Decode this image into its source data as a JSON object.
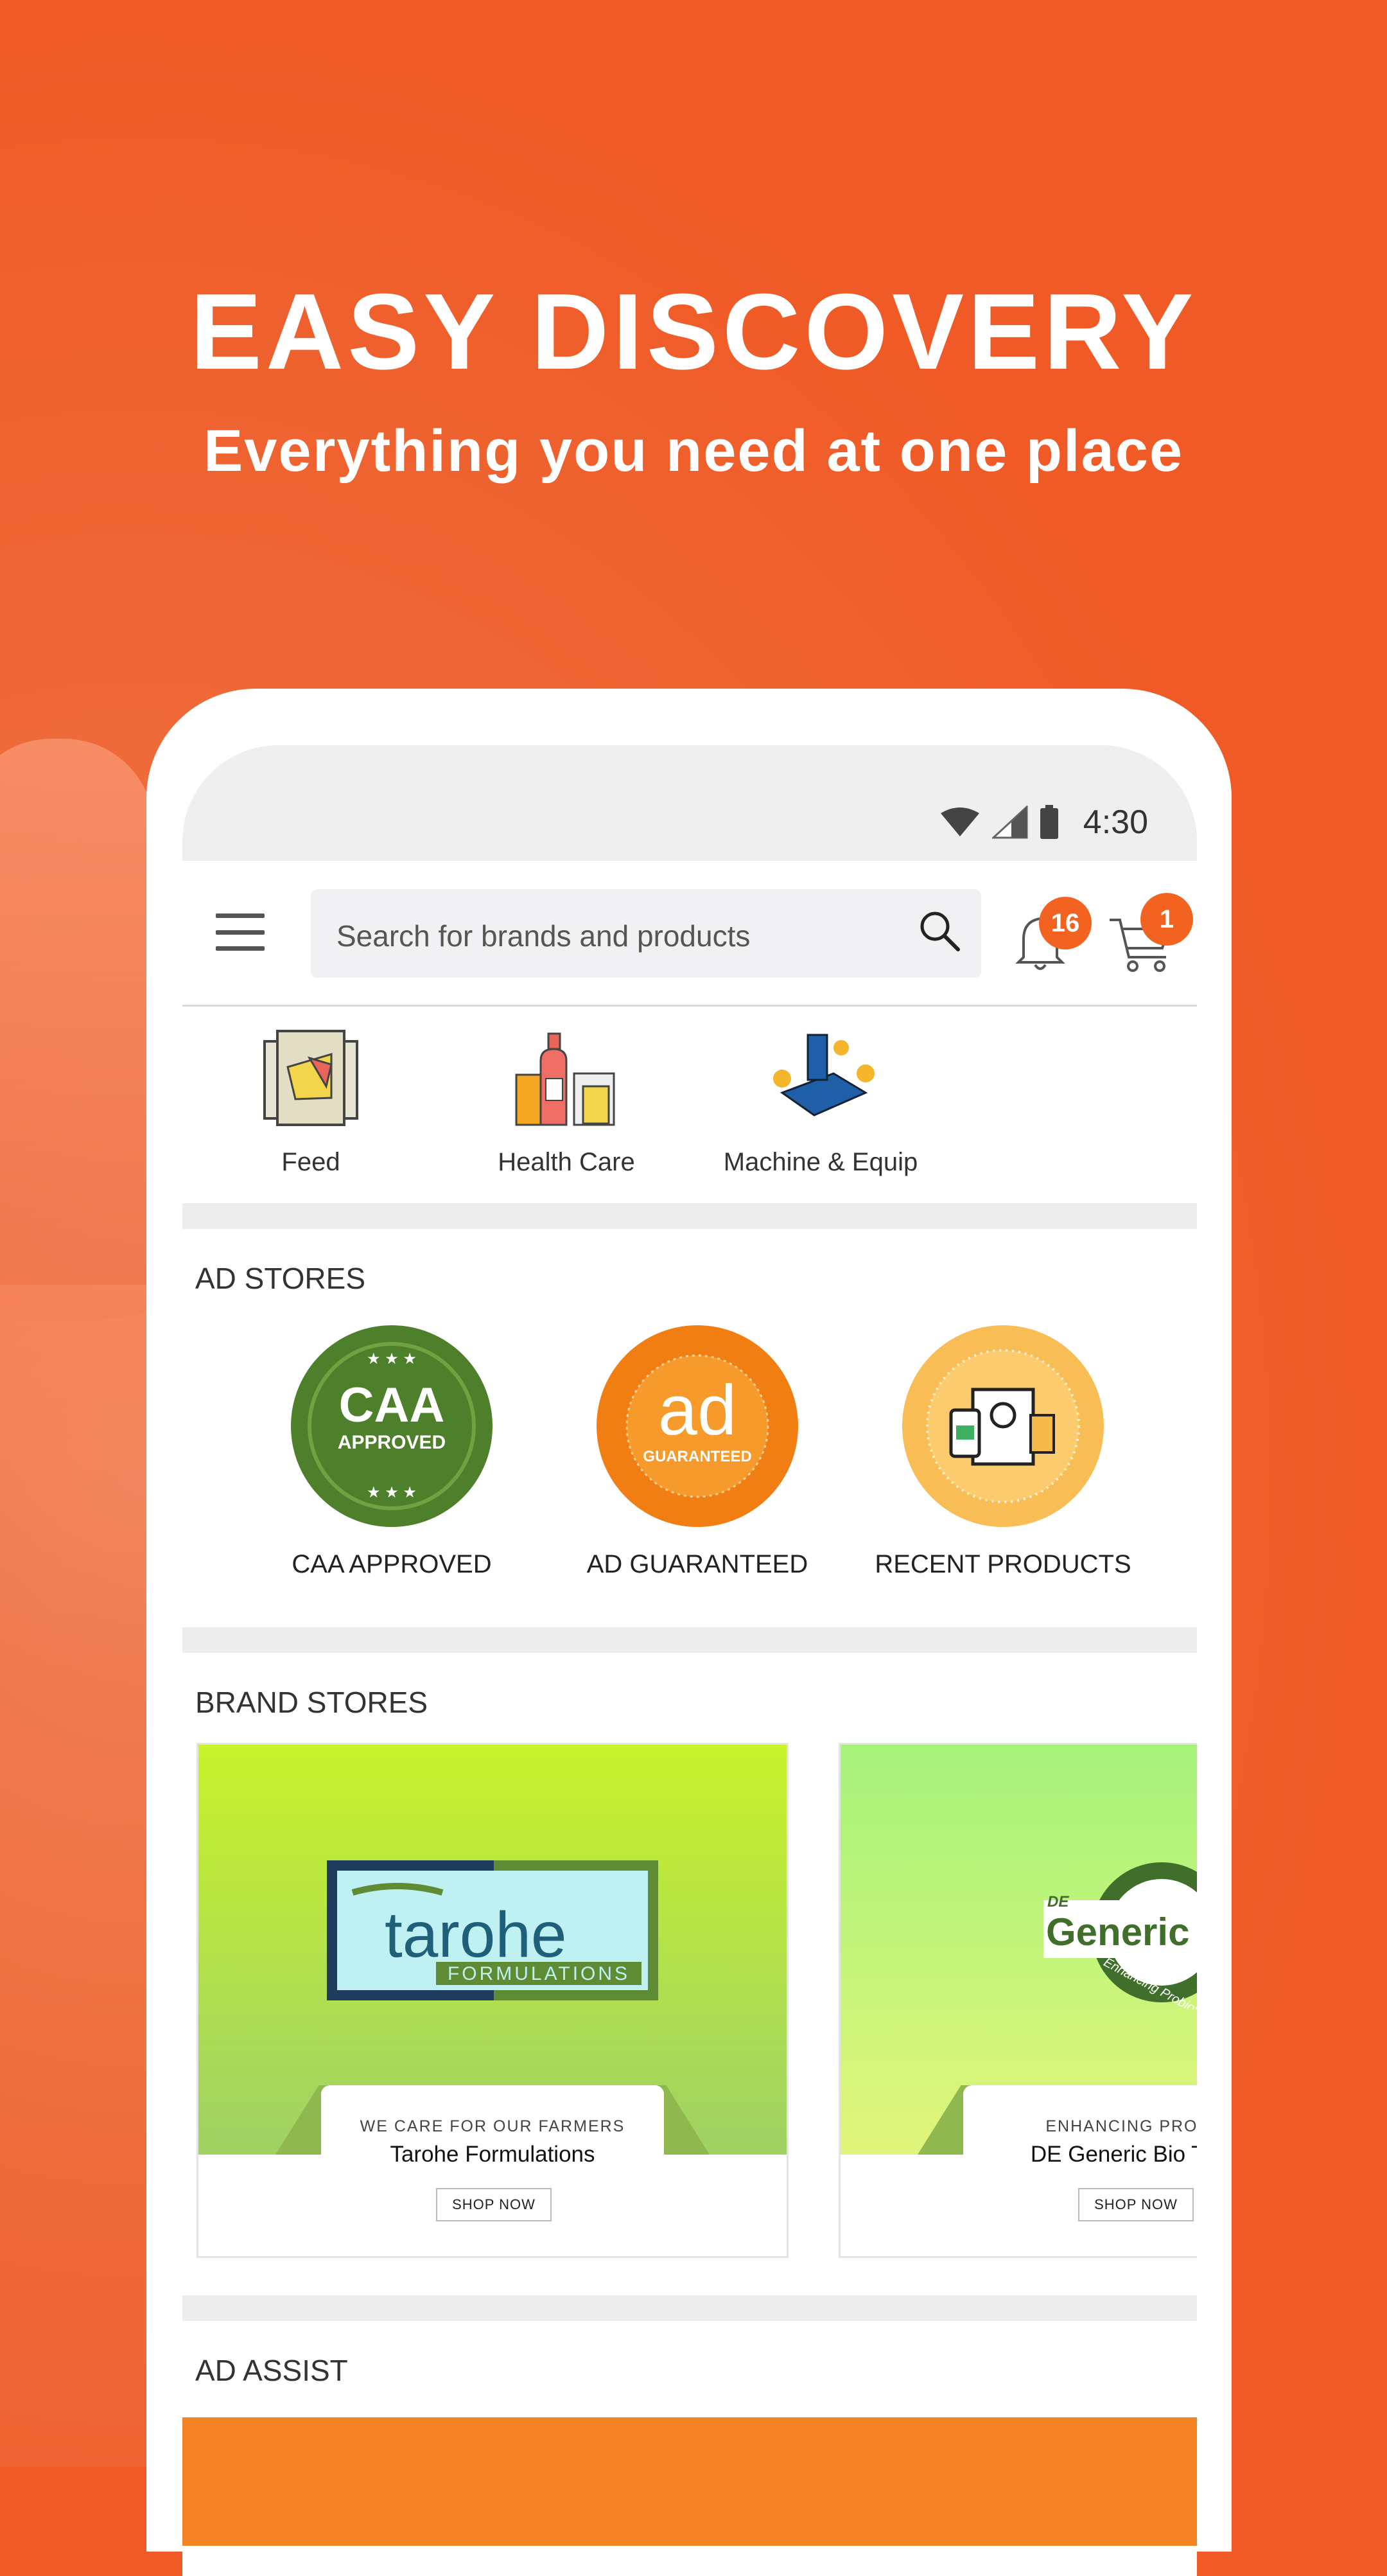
{
  "promo": {
    "headline": "EASY DISCOVERY",
    "subheadline": "Everything you need at one place"
  },
  "status_bar": {
    "time": "4:30"
  },
  "app_bar": {
    "search_placeholder": "Search for brands and products",
    "notifications_count": "16",
    "cart_count": "1"
  },
  "categories": [
    {
      "label": "Feed",
      "icon": "feed-bag-icon"
    },
    {
      "label": "Health Care",
      "icon": "health-care-icon"
    },
    {
      "label": "Machine & Equip",
      "icon": "aerator-machine-icon"
    }
  ],
  "ad_stores": {
    "title": "AD STORES",
    "items": [
      {
        "label": "CAA APPROVED",
        "badge_big": "CAA",
        "badge_small": "APPROVED",
        "color": "#4E7F2A"
      },
      {
        "label": "AD GUARANTEED",
        "badge_big": "ad",
        "badge_small": "GUARANTEED",
        "color": "#F07E12"
      },
      {
        "label": "RECENT PRODUCTS",
        "color": "#F8BE55"
      }
    ]
  },
  "brand_stores": {
    "title": "BRAND STORES",
    "items": [
      {
        "logo_text": "tarohe",
        "logo_sub": "FORMULATIONS",
        "tagline": "WE CARE FOR OUR FARMERS",
        "name": "Tarohe Formulations",
        "button": "SHOP NOW"
      },
      {
        "logo_prefix": "DE",
        "logo_text": "Generic",
        "logo_arc": "Enhancing Probiotics",
        "tagline": "ENHANCING PRODU",
        "name": "DE Generic Bio Tech",
        "button": "SHOP NOW"
      }
    ]
  },
  "ad_assist": {
    "title": "AD ASSIST"
  },
  "colors": {
    "accent": "#F26322",
    "background": "#EF5A26",
    "caa_green": "#4E7F2A"
  }
}
